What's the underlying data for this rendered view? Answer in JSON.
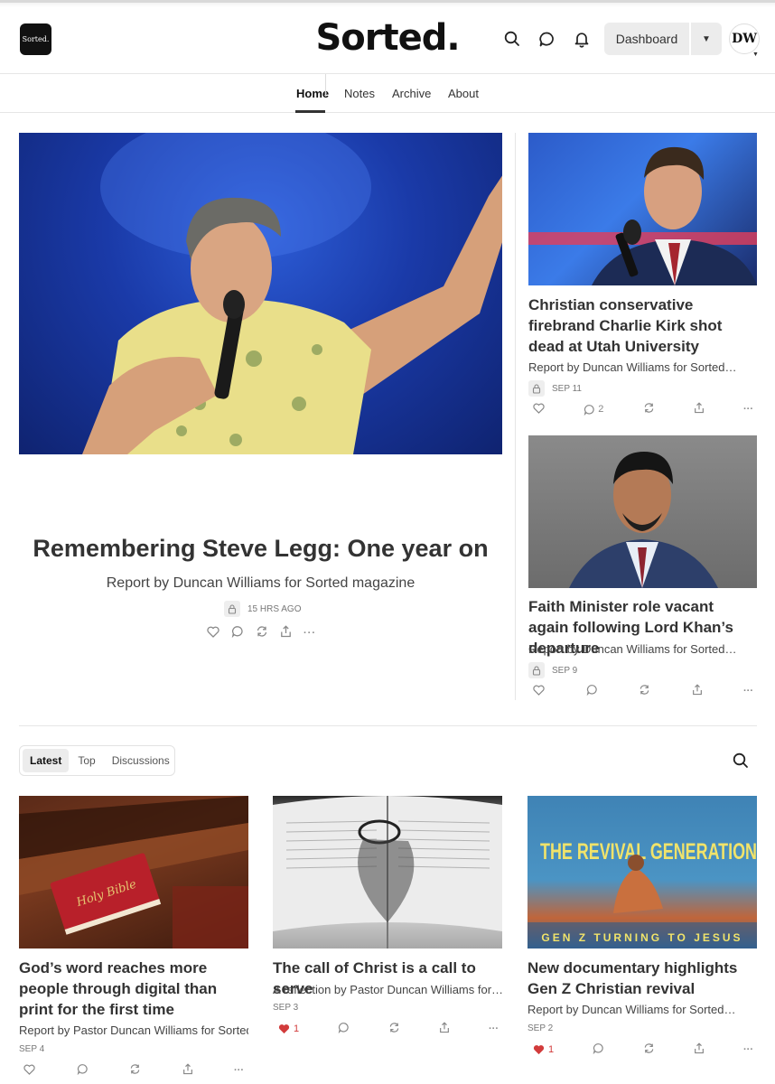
{
  "header": {
    "logo_small": "Sorted.",
    "masthead": "Sorted.",
    "dashboard_label": "Dashboard",
    "avatar_initials": "DW"
  },
  "nav": {
    "items": [
      {
        "label": "Home"
      },
      {
        "label": "Notes"
      },
      {
        "label": "Archive"
      },
      {
        "label": "About"
      }
    ]
  },
  "hero": {
    "title": "Remembering Steve Legg: One year on",
    "subtitle": "Report by Duncan Williams for Sorted magazine",
    "date": "15 HRS AGO"
  },
  "side_posts": [
    {
      "title": "Christian conservative firebrand Charlie Kirk shot dead at Utah University",
      "subtitle": "Report by Duncan Williams for Sorted…",
      "date": "SEP 11",
      "comments": "2"
    },
    {
      "title": "Faith Minister role vacant again following Lord Khan’s departure",
      "subtitle": "Report by Duncan Williams for Sorted…",
      "date": "SEP 9"
    }
  ],
  "feed": {
    "tabs": [
      {
        "label": "Latest"
      },
      {
        "label": "Top"
      },
      {
        "label": "Discussions"
      }
    ],
    "cards": [
      {
        "title": "God’s word reaches more people through digital than print for the first time",
        "subtitle": "Report by Pastor Duncan Williams for Sorted…",
        "date": "SEP 4",
        "image_text": "Holy Bible"
      },
      {
        "title": "The call of Christ is a call to serve",
        "subtitle": "A reflection by Pastor Duncan Williams for…",
        "date": "SEP 3",
        "likes": "1"
      },
      {
        "title": "New documentary highlights Gen Z Christian revival",
        "subtitle": "Report by Duncan Williams for Sorted…",
        "date": "SEP 2",
        "likes": "1",
        "image_title": "THE REVIVAL GENERATION",
        "image_caption": "GEN Z TURNING TO JESUS"
      }
    ]
  },
  "colors": {
    "accent_heart": "#d23b3b",
    "text": "#333333"
  }
}
